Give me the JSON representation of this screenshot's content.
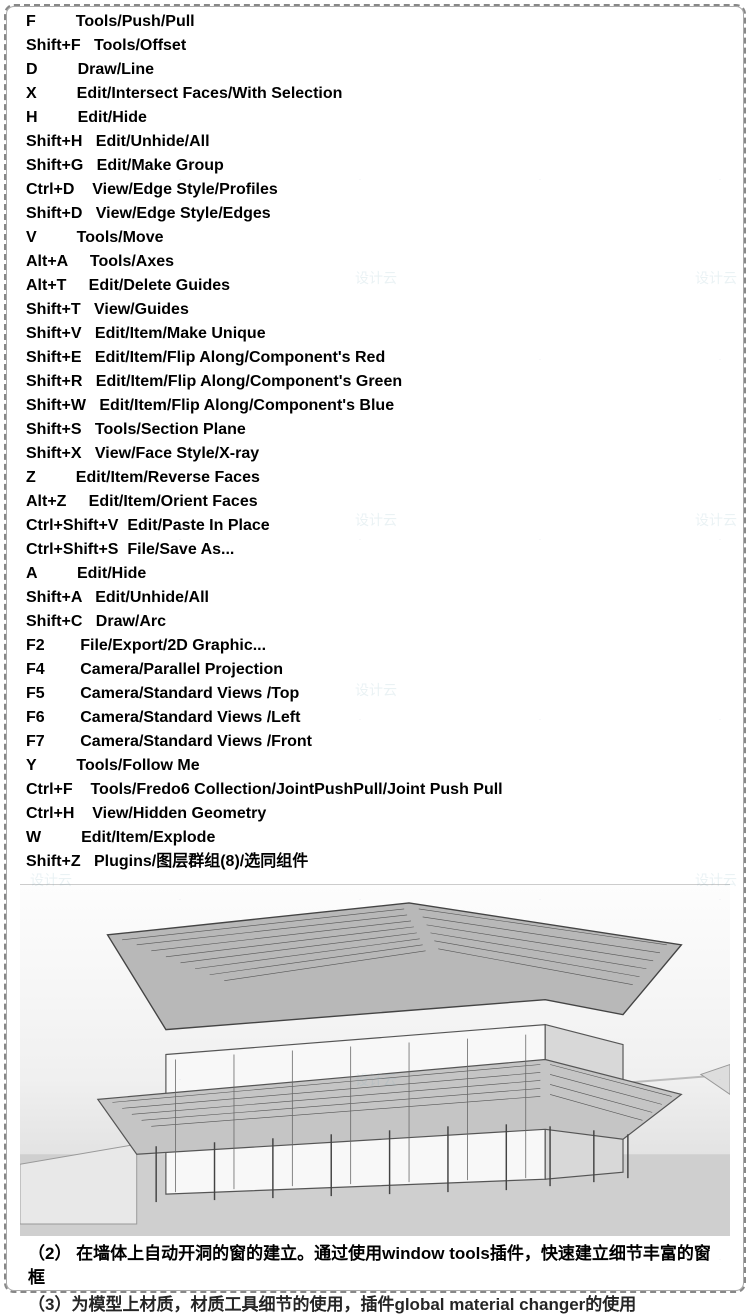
{
  "shortcuts": [
    {
      "key": "F",
      "cmd": "Tools/Push/Pull"
    },
    {
      "key": "Shift+F",
      "cmd": "Tools/Offset"
    },
    {
      "key": "D",
      "cmd": "Draw/Line"
    },
    {
      "key": "X",
      "cmd": "Edit/Intersect Faces/With Selection"
    },
    {
      "key": "H",
      "cmd": "Edit/Hide"
    },
    {
      "key": "Shift+H",
      "cmd": "Edit/Unhide/All"
    },
    {
      "key": "Shift+G",
      "cmd": "Edit/Make Group"
    },
    {
      "key": "Ctrl+D",
      "cmd": "View/Edge Style/Profiles"
    },
    {
      "key": "Shift+D",
      "cmd": "View/Edge Style/Edges"
    },
    {
      "key": "V",
      "cmd": "Tools/Move"
    },
    {
      "key": "Alt+A",
      "cmd": "Tools/Axes"
    },
    {
      "key": "Alt+T",
      "cmd": "Edit/Delete Guides"
    },
    {
      "key": "Shift+T",
      "cmd": "View/Guides"
    },
    {
      "key": "Shift+V",
      "cmd": "Edit/Item/Make Unique"
    },
    {
      "key": "Shift+E",
      "cmd": "Edit/Item/Flip Along/Component's Red"
    },
    {
      "key": "Shift+R",
      "cmd": "Edit/Item/Flip Along/Component's Green"
    },
    {
      "key": "Shift+W",
      "cmd": "Edit/Item/Flip Along/Component's Blue"
    },
    {
      "key": "Shift+S",
      "cmd": "Tools/Section Plane"
    },
    {
      "key": "Shift+X",
      "cmd": "View/Face Style/X-ray"
    },
    {
      "key": "Z",
      "cmd": "Edit/Item/Reverse Faces"
    },
    {
      "key": "Alt+Z",
      "cmd": "Edit/Item/Orient Faces"
    },
    {
      "key": "Ctrl+Shift+V",
      "cmd": "Edit/Paste In Place"
    },
    {
      "key": "Ctrl+Shift+S",
      "cmd": "File/Save As..."
    },
    {
      "key": "A",
      "cmd": "Edit/Hide"
    },
    {
      "key": "Shift+A",
      "cmd": "Edit/Unhide/All"
    },
    {
      "key": "Shift+C",
      "cmd": "Draw/Arc"
    },
    {
      "key": "F2",
      "cmd": "File/Export/2D Graphic..."
    },
    {
      "key": "F4",
      "cmd": "Camera/Parallel Projection"
    },
    {
      "key": "F5",
      "cmd": "Camera/Standard Views /Top"
    },
    {
      "key": "F6",
      "cmd": "Camera/Standard Views /Left"
    },
    {
      "key": "F7",
      "cmd": "Camera/Standard Views /Front"
    },
    {
      "key": "Y",
      "cmd": "Tools/Follow Me"
    },
    {
      "key": "Ctrl+F",
      "cmd": "Tools/Fredo6 Collection/JointPushPull/Joint Push Pull"
    },
    {
      "key": "Ctrl+H",
      "cmd": "View/Hidden Geometry"
    },
    {
      "key": "W",
      "cmd": "Edit/Item/Explode"
    },
    {
      "key": "Shift+Z",
      "cmd": "Plugins/图层群组(8)/选同组件"
    }
  ],
  "caption2": "（2）    在墙体上自动开洞的窗的建立。通过使用window tools插件，快速建立细节丰富的窗框",
  "caption3": "（3）为模型上材质，材质工具细节的使用，插件global material changer的使用",
  "watermark": "设计云"
}
